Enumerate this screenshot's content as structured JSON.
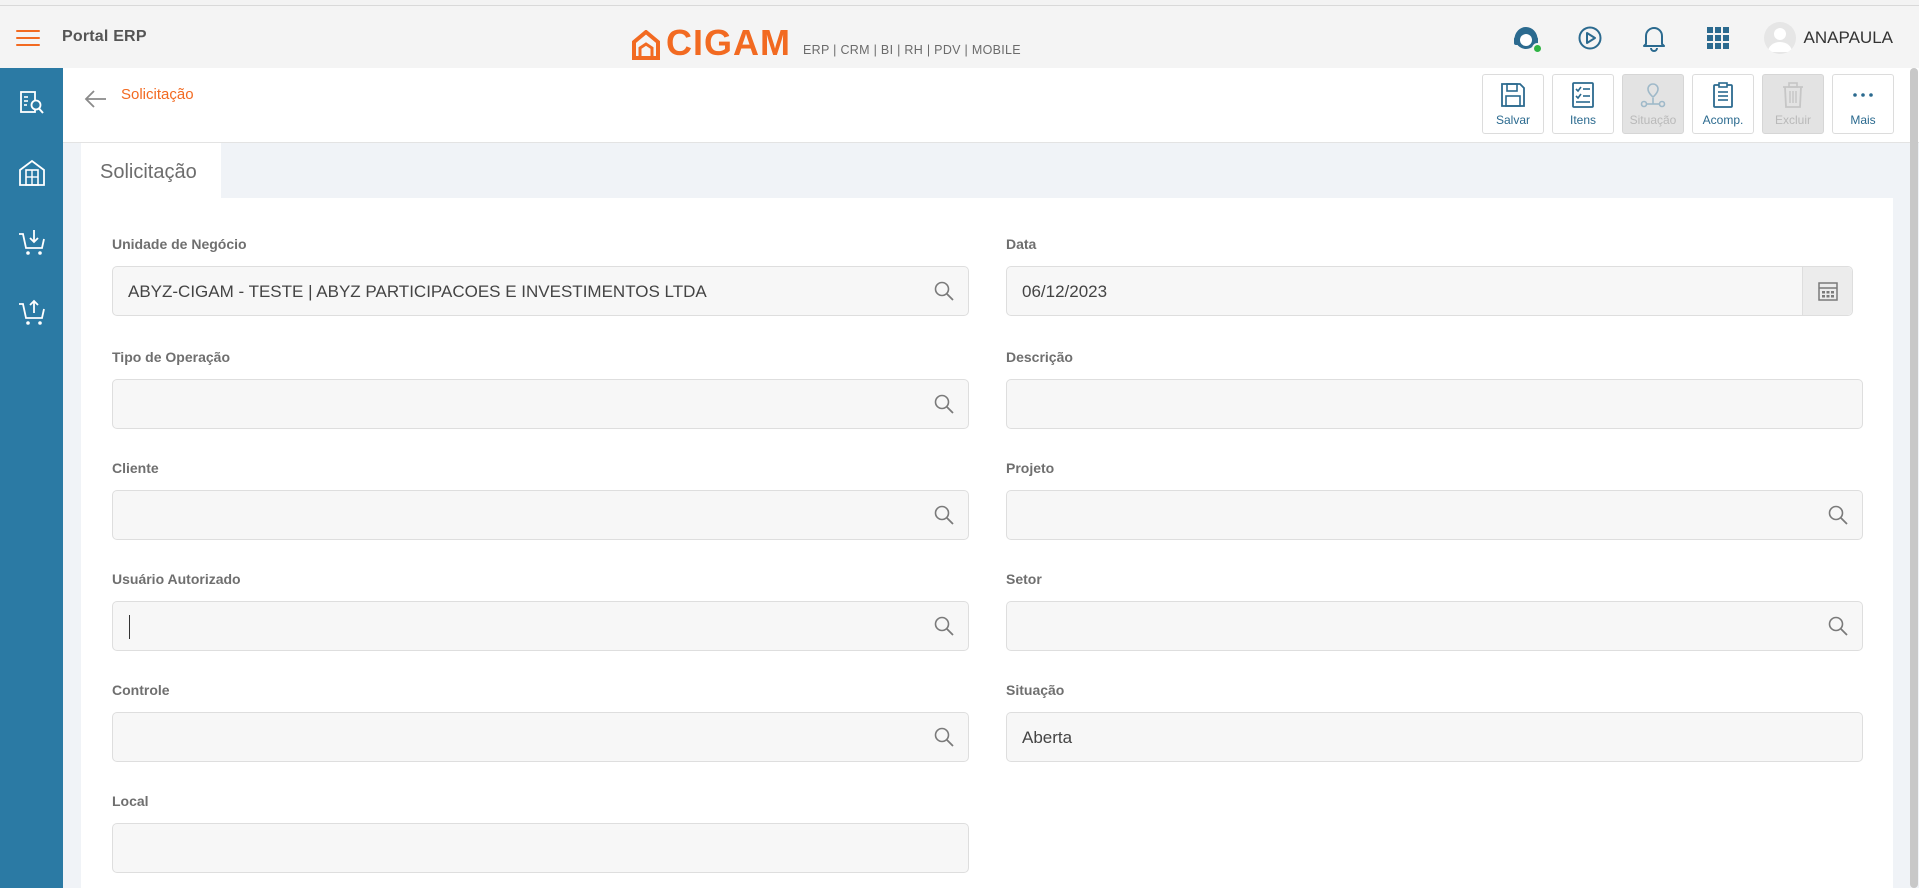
{
  "header": {
    "app_title": "Portal ERP",
    "logo_text": "CIGAM",
    "logo_tagline": "ERP | CRM | BI | RH | PDV | MOBILE",
    "user_name": "ANAPAULA",
    "icons": [
      "support-headset-icon",
      "play-icon",
      "bell-icon",
      "apps-grid-icon",
      "user-avatar-icon"
    ],
    "brand_color": "#f26a21",
    "nav_color": "#2b7aa4"
  },
  "sidenav": {
    "items": [
      {
        "icon": "report-search-icon"
      },
      {
        "icon": "building-icon"
      },
      {
        "icon": "cart-download-icon"
      },
      {
        "icon": "cart-upload-icon"
      }
    ]
  },
  "subheader": {
    "breadcrumb": "Solicitação",
    "actions": [
      {
        "label": "Salvar",
        "icon": "save-icon",
        "enabled": true
      },
      {
        "label": "Itens",
        "icon": "checklist-icon",
        "enabled": true
      },
      {
        "label": "Situação",
        "icon": "workflow-icon",
        "enabled": false
      },
      {
        "label": "Acomp.",
        "icon": "clipboard-icon",
        "enabled": true
      },
      {
        "label": "Excluir",
        "icon": "trash-icon",
        "enabled": false
      },
      {
        "label": "Mais",
        "icon": "more-icon",
        "enabled": true
      }
    ]
  },
  "tab": {
    "label": "Solicitação"
  },
  "form": {
    "unidade_label": "Unidade de Negócio",
    "unidade_value": "ABYZ-CIGAM - TESTE | ABYZ PARTICIPACOES E INVESTIMENTOS LTDA",
    "data_label": "Data",
    "data_value": "06/12/2023",
    "tipo_label": "Tipo de Operação",
    "tipo_value": "",
    "descricao_label": "Descrição",
    "descricao_value": "",
    "cliente_label": "Cliente",
    "cliente_value": "",
    "projeto_label": "Projeto",
    "projeto_value": "",
    "usuario_label": "Usuário Autorizado",
    "usuario_value": "",
    "setor_label": "Setor",
    "setor_value": "",
    "controle_label": "Controle",
    "controle_value": "",
    "situacao_label": "Situação",
    "situacao_value": "Aberta",
    "local_label": "Local",
    "local_value": ""
  }
}
